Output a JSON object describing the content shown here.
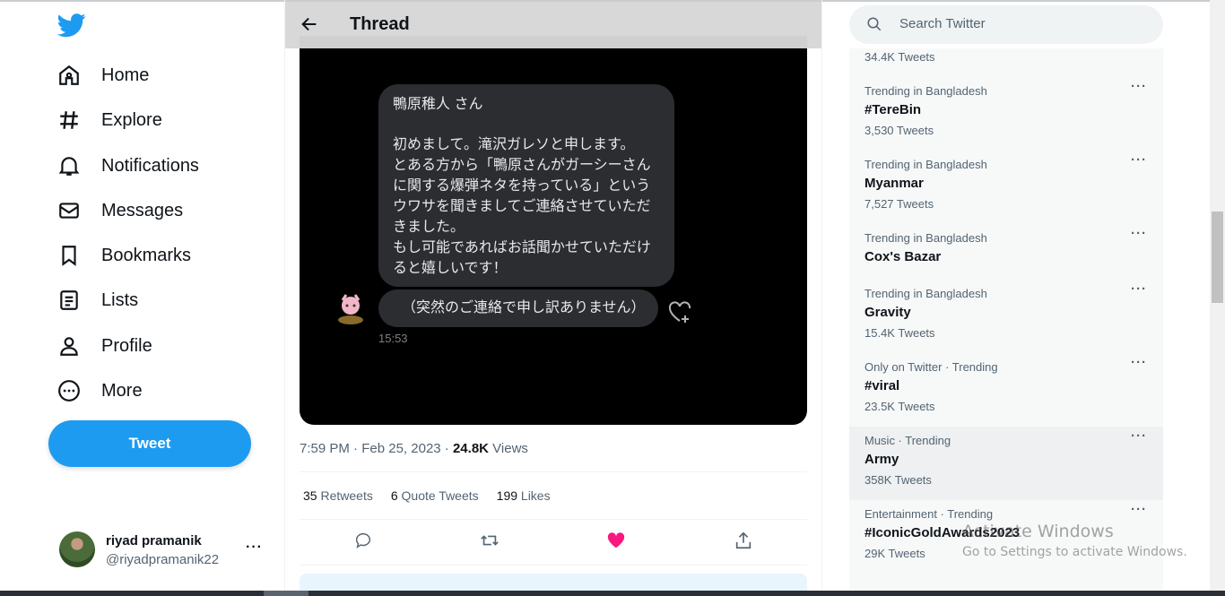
{
  "sidebar": {
    "logo": "twitter-bird-icon",
    "nav": [
      {
        "label": "Home",
        "icon": "home-icon"
      },
      {
        "label": "Explore",
        "icon": "hashtag-icon"
      },
      {
        "label": "Notifications",
        "icon": "bell-icon"
      },
      {
        "label": "Messages",
        "icon": "envelope-icon"
      },
      {
        "label": "Bookmarks",
        "icon": "bookmark-icon"
      },
      {
        "label": "Lists",
        "icon": "list-icon"
      },
      {
        "label": "Profile",
        "icon": "person-icon"
      },
      {
        "label": "More",
        "icon": "more-circle-icon"
      }
    ],
    "tweet_button": "Tweet",
    "account": {
      "name": "riyad pramanik",
      "handle": "@riyadpramanik22",
      "more": "···"
    }
  },
  "main": {
    "header_title": "Thread",
    "media": {
      "greeting": "鴨原稚人 さん",
      "message": "初めまして。滝沢ガレソと申します。\nとある方から「鴨原さんがガーシーさん\nに関する爆弾ネタを持っている」という\nウワサを聞きましてご連絡させていただ\nきました。\nもし可能であればお話聞かせていただけ\nると嬉しいです！",
      "message2": "（突然のご連絡で申し訳ありません）",
      "time": "15:53"
    },
    "meta": {
      "time": "7:59 PM",
      "sep": "·",
      "date": "Feb 25, 2023",
      "views_count": "24.8K",
      "views_label": "Views"
    },
    "stats": {
      "retweets_count": "35",
      "retweets_label": "Retweets",
      "quotes_count": "6",
      "quotes_label": "Quote Tweets",
      "likes_count": "199",
      "likes_label": "Likes"
    },
    "like_color": "#f91880"
  },
  "right": {
    "search_placeholder": "Search Twitter",
    "top_partial_count": "34.4K Tweets",
    "trends": [
      {
        "context": "Trending in Bangladesh",
        "name": "#TereBin",
        "count": "3,530 Tweets"
      },
      {
        "context": "Trending in Bangladesh",
        "name": "Myanmar",
        "count": "7,527 Tweets"
      },
      {
        "context": "Trending in Bangladesh",
        "name": "Cox's Bazar",
        "count": ""
      },
      {
        "context": "Trending in Bangladesh",
        "name": "Gravity",
        "count": "15.4K Tweets"
      },
      {
        "context": "Only on Twitter · Trending",
        "name": "#viral",
        "count": "23.5K Tweets"
      },
      {
        "context": "Music · Trending",
        "name": "Army",
        "count": "358K Tweets"
      },
      {
        "context": "Entertainment · Trending",
        "name": "#IconicGoldAwards2023",
        "count": "29K Tweets"
      }
    ],
    "more_glyph": "···"
  },
  "watermark": {
    "title": "Activate Windows",
    "subtitle": "Go to Settings to activate Windows."
  },
  "accent_color": "#1d9bf0"
}
